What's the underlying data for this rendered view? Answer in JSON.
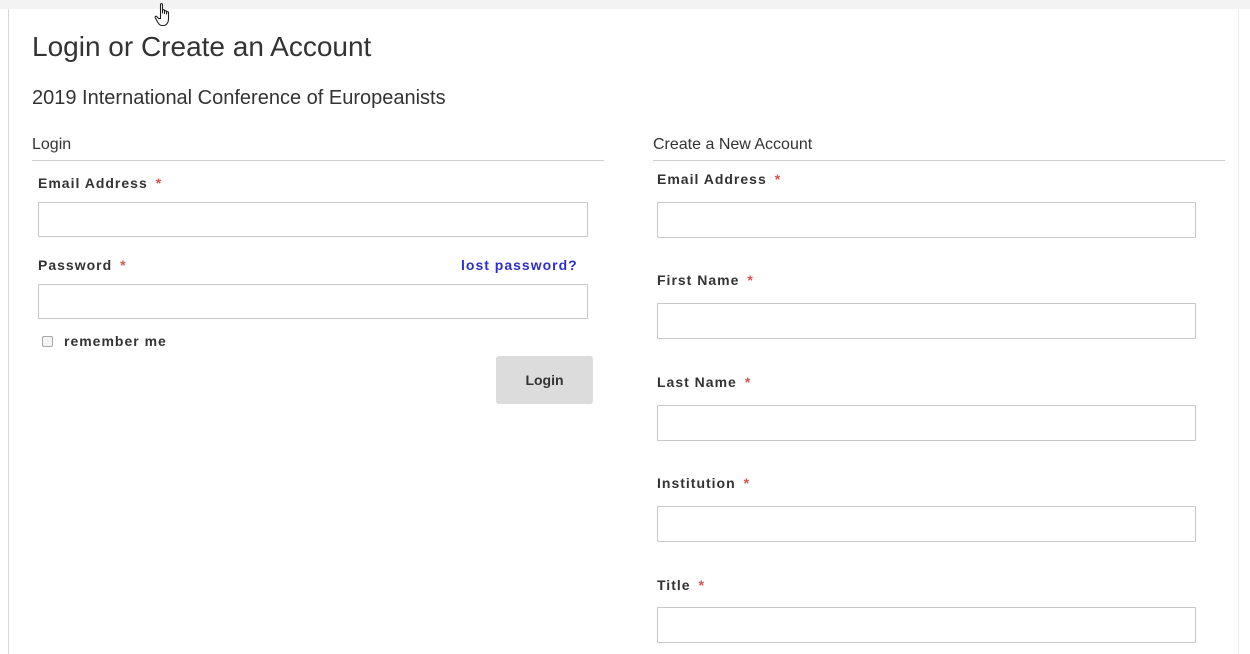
{
  "page": {
    "title": "Login or Create an Account",
    "subtitle": "2019 International Conference of Europeanists"
  },
  "login": {
    "section_title": "Login",
    "email_label": "Email Address",
    "email_value": "",
    "password_label": "Password",
    "password_value": "",
    "lost_password": "lost password?",
    "remember_label": "remember me",
    "remember_checked": false,
    "button_label": "Login"
  },
  "create": {
    "section_title": "Create a New Account",
    "fields": [
      {
        "label": "Email Address",
        "value": ""
      },
      {
        "label": "First Name",
        "value": ""
      },
      {
        "label": "Last Name",
        "value": ""
      },
      {
        "label": "Institution",
        "value": ""
      },
      {
        "label": "Title",
        "value": ""
      }
    ]
  },
  "required_marker": "*",
  "colors": {
    "required": "#d9534f",
    "link": "#2d2fc9",
    "button_bg": "#dcdcdc",
    "input_border": "#c8c8c8"
  },
  "icons": {
    "cursor": "hand-pointer-cursor"
  }
}
